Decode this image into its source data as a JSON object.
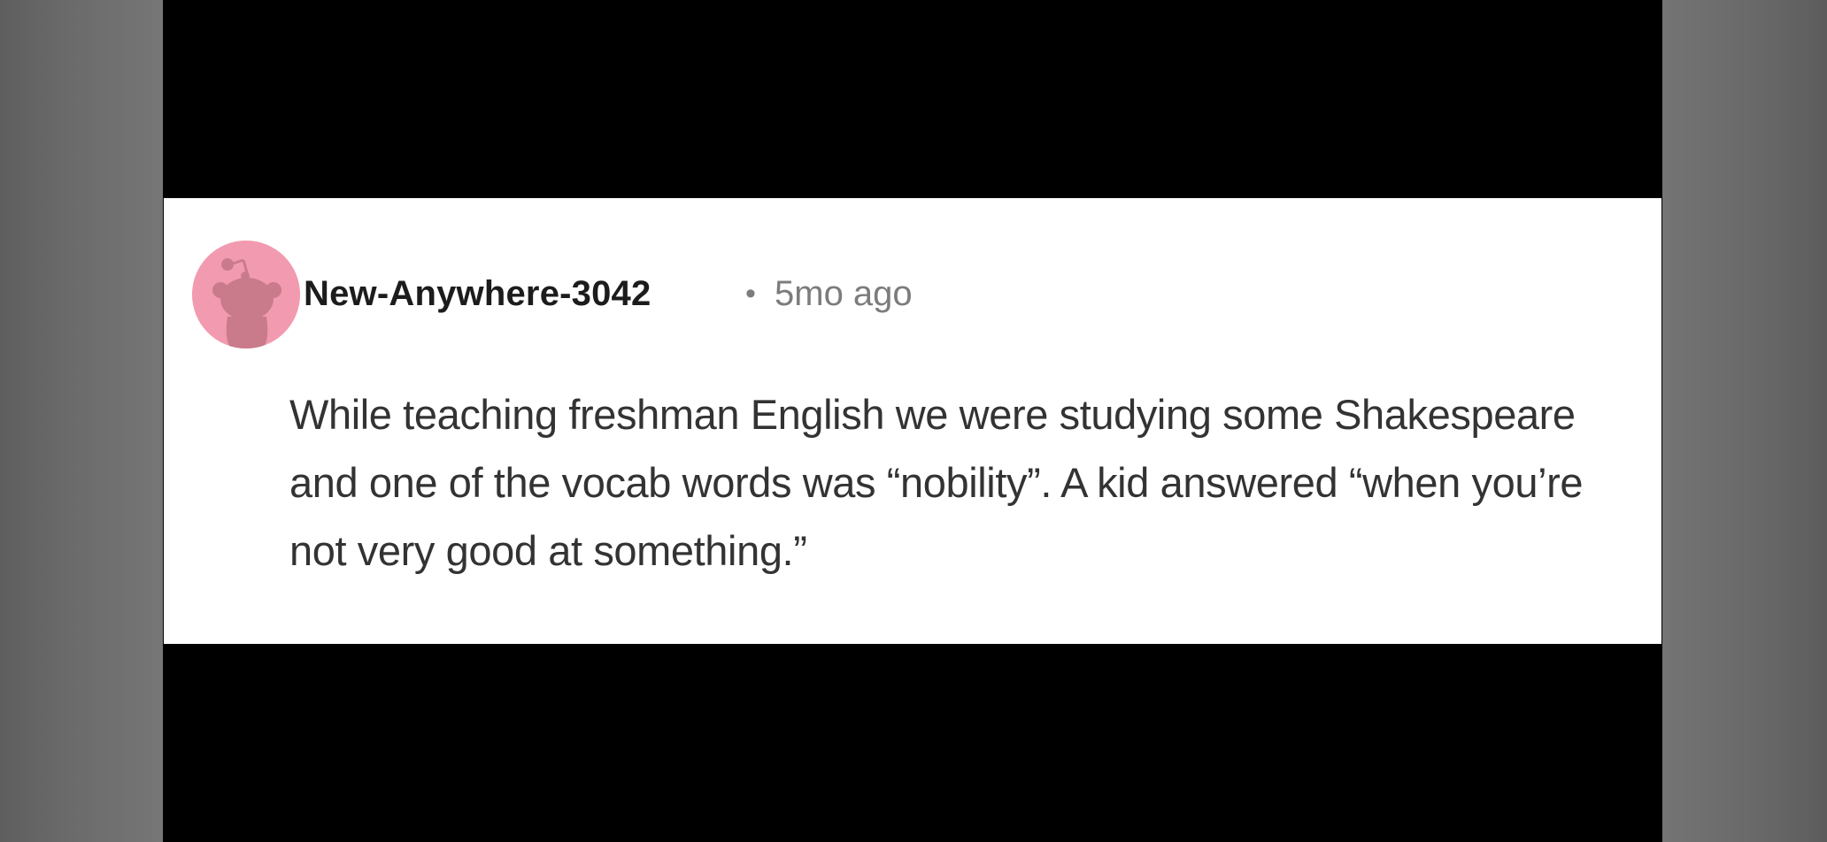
{
  "comment": {
    "author": "New-Anywhere-3042",
    "separator": "•",
    "timestamp": "5mo ago",
    "avatar_icon": "reddit-snoo-avatar-icon",
    "avatar_color": "#f29bb0",
    "body": "While teaching freshman English we were studying some Shakespeare and one of the vocab words was “nobility”. A kid answered “when you’re not very good at something.”"
  }
}
